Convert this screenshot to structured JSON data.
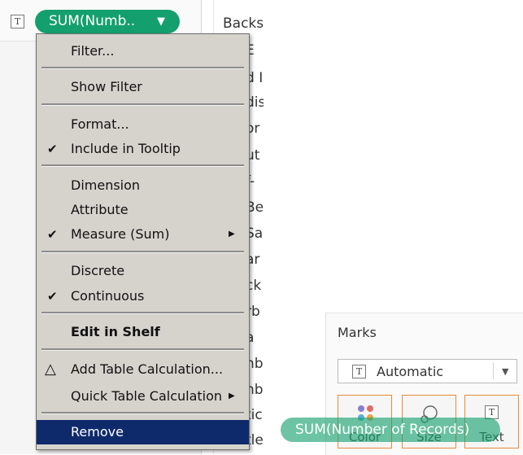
{
  "shelf": {
    "pill_label": "SUM(Numb..",
    "pill_caret": "▼",
    "text_icon": "T"
  },
  "sheet": {
    "header_text": "Backs",
    "fragments": [
      "E",
      "d I",
      "dis",
      "or",
      "ut",
      "f-",
      "Be",
      "Sa",
      "ar",
      "ck",
      "rb",
      "a",
      "nb",
      "nb",
      "tic",
      "tle"
    ]
  },
  "context_menu": {
    "items": [
      {
        "label": "Filter...",
        "check": "",
        "arrow": ""
      },
      {
        "label": "Show Filter",
        "check": "",
        "arrow": ""
      },
      {
        "label": "Format...",
        "check": "",
        "arrow": ""
      },
      {
        "label": "Include in Tooltip",
        "check": "✔",
        "arrow": ""
      },
      {
        "label": "Dimension",
        "check": "",
        "arrow": ""
      },
      {
        "label": "Attribute",
        "check": "",
        "arrow": ""
      },
      {
        "label": "Measure (Sum)",
        "check": "✔",
        "arrow": "▶"
      },
      {
        "label": "Discrete",
        "check": "",
        "arrow": ""
      },
      {
        "label": "Continuous",
        "check": "✔",
        "arrow": ""
      },
      {
        "label": "Edit in Shelf",
        "check": "",
        "arrow": ""
      },
      {
        "label": "Add Table Calculation...",
        "check": "△",
        "arrow": ""
      },
      {
        "label": "Quick Table Calculation",
        "check": "",
        "arrow": "▶"
      },
      {
        "label": "Remove",
        "check": "",
        "arrow": ""
      }
    ]
  },
  "marks": {
    "title": "Marks",
    "mark_type": "Automatic",
    "mark_type_icon": "T",
    "dropdown_arrow": "▼",
    "buttons": [
      {
        "label": "Color",
        "icon": "color-dots-icon"
      },
      {
        "label": "Size",
        "icon": "size-circles-icon"
      },
      {
        "label": "Text",
        "icon": "T"
      }
    ]
  },
  "drag": {
    "pill_label": "SUM(Number of Records)"
  },
  "colors": {
    "pill_green": "#14a06e",
    "menu_bg": "#d6d3cd",
    "menu_selected": "#0f2a6b",
    "mark_button_border": "#e88a3a"
  }
}
